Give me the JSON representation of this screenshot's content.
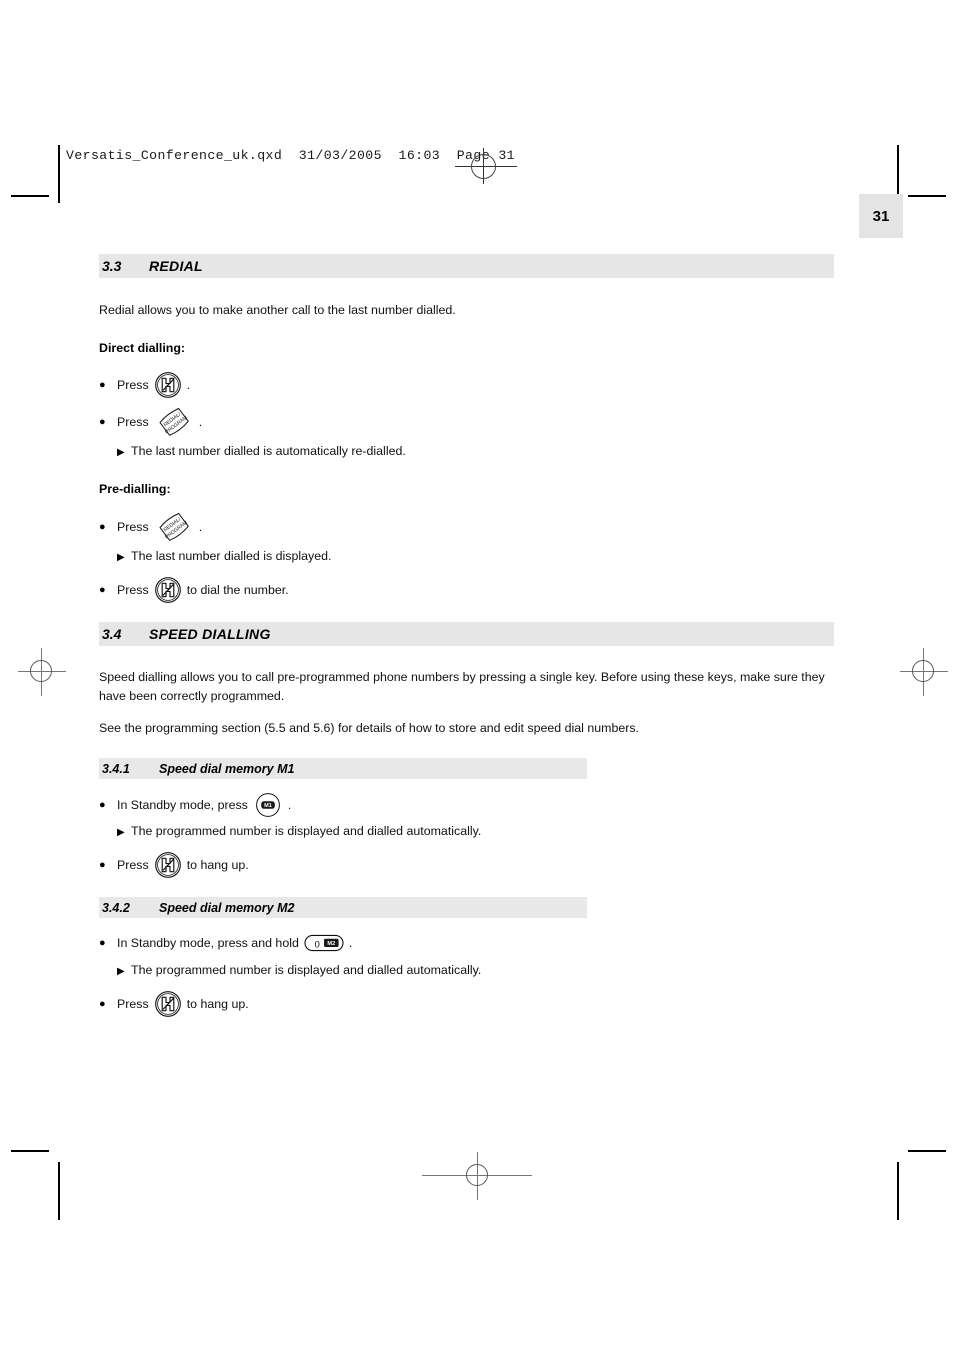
{
  "file_header": "Versatis_Conference_uk.qxd  31/03/2005  16:03  Page 31",
  "page_number": "31",
  "sections": [
    {
      "number": "3.3",
      "title": "REDIAL",
      "intro": "Redial allows you to make another call to the last number dialled.",
      "groups": [
        {
          "heading": "Direct dialling:",
          "steps": [
            {
              "prefix": "Press",
              "icon": "handset-key-icon",
              "suffix": "."
            },
            {
              "prefix": "Press",
              "icon": "redial-program-key-icon",
              "suffix": "."
            },
            {
              "arrow": "The last number dialled is automatically re-dialled."
            }
          ]
        },
        {
          "heading": "Pre-dialling:",
          "steps": [
            {
              "prefix": "Press",
              "icon": "redial-program-key-icon",
              "suffix": "."
            },
            {
              "arrow": "The last number dialled is displayed."
            },
            {
              "prefix": "Press",
              "icon": "handset-key-icon",
              "suffix": "to dial the number."
            }
          ]
        }
      ]
    },
    {
      "number": "3.4",
      "title": "SPEED DIALLING",
      "paragraphs": [
        "Speed dialling allows you to call pre-programmed phone numbers by pressing a single key. Before using these keys, make sure they have been correctly programmed.",
        "See the programming section (5.5 and 5.6) for details of how to store and edit speed dial numbers."
      ],
      "subsections": [
        {
          "number": "3.4.1",
          "title": "Speed dial memory M1",
          "steps": [
            {
              "prefix": "In Standby mode, press",
              "icon": "m1-memory-key-icon",
              "suffix": "."
            },
            {
              "arrow": "The programmed number is displayed and dialled automatically."
            },
            {
              "prefix": "Press",
              "icon": "handset-key-icon",
              "suffix": "to hang up."
            }
          ]
        },
        {
          "number": "3.4.2",
          "title": "Speed dial memory M2",
          "steps": [
            {
              "prefix": "In Standby mode, press and hold",
              "icon": "m2-memory-key-icon",
              "suffix": "."
            },
            {
              "arrow": "The programmed number is displayed and dialled automatically."
            },
            {
              "prefix": "Press",
              "icon": "handset-key-icon",
              "suffix": "to hang up."
            }
          ]
        }
      ]
    }
  ],
  "icon_labels": {
    "redial_program_line1": "REDIAL/",
    "redial_program_line2": "PROGRAM",
    "m1_label": "M1",
    "m2_key_digit": "0",
    "m2_label": "M2"
  },
  "glyphs": {
    "bullet": "●",
    "arrow": "▶"
  },
  "colors": {
    "section_bar": "#e6e6e6",
    "subsection_bar": "#e8e8e8",
    "page_badge": "#e4e4e4",
    "text": "#111111"
  }
}
